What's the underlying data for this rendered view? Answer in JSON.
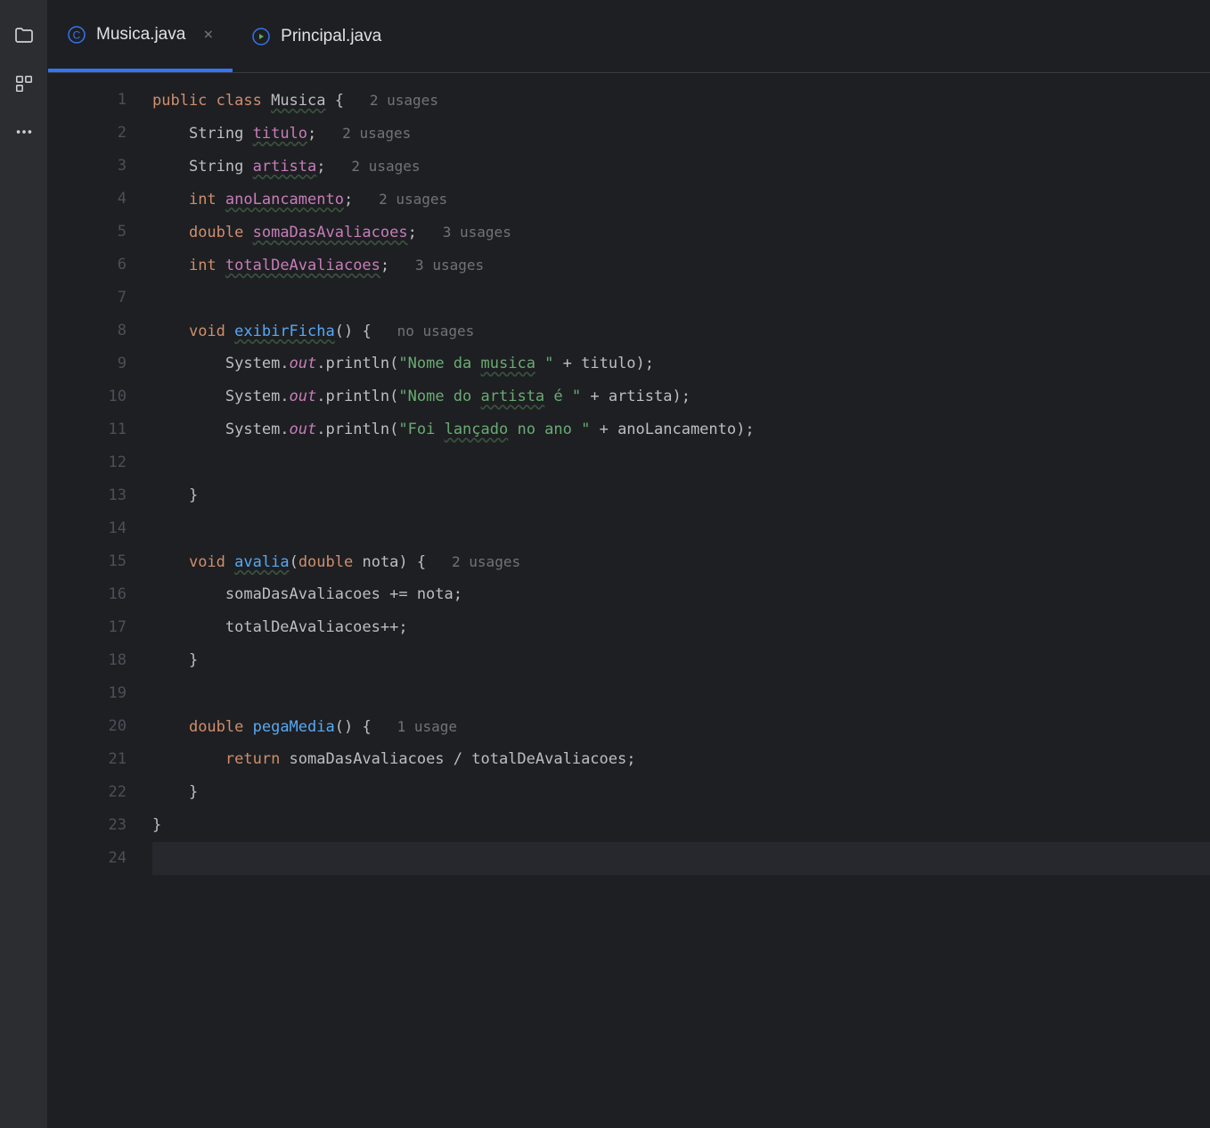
{
  "sidebar": {
    "icons": [
      "folder",
      "structure",
      "more"
    ]
  },
  "tabs": [
    {
      "label": "Musica.java",
      "icon": "class",
      "active": true,
      "closable": true
    },
    {
      "label": "Principal.java",
      "icon": "run-class",
      "active": false,
      "closable": false
    }
  ],
  "code": {
    "lines": [
      {
        "num": 1,
        "indent": 0,
        "tokens": [
          {
            "t": "public ",
            "c": "kw"
          },
          {
            "t": "class ",
            "c": "kw"
          },
          {
            "t": "Musica",
            "c": "ident uline"
          },
          {
            "t": " {",
            "c": "ident"
          }
        ],
        "hint": "2 usages"
      },
      {
        "num": 2,
        "indent": 1,
        "tokens": [
          {
            "t": "String ",
            "c": "ident"
          },
          {
            "t": "titulo",
            "c": "field uline"
          },
          {
            "t": ";",
            "c": "ident"
          }
        ],
        "hint": "2 usages"
      },
      {
        "num": 3,
        "indent": 1,
        "tokens": [
          {
            "t": "String ",
            "c": "ident"
          },
          {
            "t": "artista",
            "c": "field uline"
          },
          {
            "t": ";",
            "c": "ident"
          }
        ],
        "hint": "2 usages"
      },
      {
        "num": 4,
        "indent": 1,
        "tokens": [
          {
            "t": "int ",
            "c": "kw"
          },
          {
            "t": "anoLancamento",
            "c": "field uline"
          },
          {
            "t": ";",
            "c": "ident"
          }
        ],
        "hint": "2 usages"
      },
      {
        "num": 5,
        "indent": 1,
        "tokens": [
          {
            "t": "double ",
            "c": "kw"
          },
          {
            "t": "somaDasAvaliacoes",
            "c": "field uline"
          },
          {
            "t": ";",
            "c": "ident"
          }
        ],
        "hint": "3 usages"
      },
      {
        "num": 6,
        "indent": 1,
        "tokens": [
          {
            "t": "int ",
            "c": "kw"
          },
          {
            "t": "totalDeAvaliacoes",
            "c": "field uline"
          },
          {
            "t": ";",
            "c": "ident"
          }
        ],
        "hint": "3 usages"
      },
      {
        "num": 7,
        "indent": 0,
        "tokens": []
      },
      {
        "num": 8,
        "indent": 1,
        "tokens": [
          {
            "t": "void ",
            "c": "kw"
          },
          {
            "t": "exibirFicha",
            "c": "method uline"
          },
          {
            "t": "() {",
            "c": "ident"
          }
        ],
        "hint": "no usages"
      },
      {
        "num": 9,
        "indent": 2,
        "tokens": [
          {
            "t": "System.",
            "c": "ident"
          },
          {
            "t": "out",
            "c": "field italic"
          },
          {
            "t": ".println(",
            "c": "ident"
          },
          {
            "t": "\"Nome da ",
            "c": "str"
          },
          {
            "t": "musica",
            "c": "str uline"
          },
          {
            "t": " \"",
            "c": "str"
          },
          {
            "t": " + titulo);",
            "c": "ident"
          }
        ]
      },
      {
        "num": 10,
        "indent": 2,
        "tokens": [
          {
            "t": "System.",
            "c": "ident"
          },
          {
            "t": "out",
            "c": "field italic"
          },
          {
            "t": ".println(",
            "c": "ident"
          },
          {
            "t": "\"Nome do ",
            "c": "str"
          },
          {
            "t": "artista",
            "c": "str uline"
          },
          {
            "t": " é \"",
            "c": "str"
          },
          {
            "t": " + artista);",
            "c": "ident"
          }
        ]
      },
      {
        "num": 11,
        "indent": 2,
        "tokens": [
          {
            "t": "System.",
            "c": "ident"
          },
          {
            "t": "out",
            "c": "field italic"
          },
          {
            "t": ".println(",
            "c": "ident"
          },
          {
            "t": "\"Foi ",
            "c": "str"
          },
          {
            "t": "lançado",
            "c": "str uline"
          },
          {
            "t": " no ano \"",
            "c": "str"
          },
          {
            "t": " + anoLancamento);",
            "c": "ident"
          }
        ]
      },
      {
        "num": 12,
        "indent": 2,
        "tokens": []
      },
      {
        "num": 13,
        "indent": 1,
        "tokens": [
          {
            "t": "}",
            "c": "ident"
          }
        ]
      },
      {
        "num": 14,
        "indent": 0,
        "tokens": []
      },
      {
        "num": 15,
        "indent": 1,
        "tokens": [
          {
            "t": "void ",
            "c": "kw"
          },
          {
            "t": "avalia",
            "c": "method uline"
          },
          {
            "t": "(",
            "c": "ident"
          },
          {
            "t": "double ",
            "c": "kw"
          },
          {
            "t": "nota) {",
            "c": "ident"
          }
        ],
        "hint": "2 usages"
      },
      {
        "num": 16,
        "indent": 2,
        "tokens": [
          {
            "t": "somaDasAvaliacoes += nota;",
            "c": "ident"
          }
        ]
      },
      {
        "num": 17,
        "indent": 2,
        "tokens": [
          {
            "t": "totalDeAvaliacoes++;",
            "c": "ident"
          }
        ]
      },
      {
        "num": 18,
        "indent": 1,
        "tokens": [
          {
            "t": "}",
            "c": "ident"
          }
        ]
      },
      {
        "num": 19,
        "indent": 0,
        "tokens": []
      },
      {
        "num": 20,
        "indent": 1,
        "tokens": [
          {
            "t": "double ",
            "c": "kw"
          },
          {
            "t": "pegaMedia",
            "c": "method"
          },
          {
            "t": "() {",
            "c": "ident"
          }
        ],
        "hint": "1 usage"
      },
      {
        "num": 21,
        "indent": 2,
        "tokens": [
          {
            "t": "return ",
            "c": "kw"
          },
          {
            "t": "somaDasAvaliacoes / totalDeAvaliacoes;",
            "c": "ident"
          }
        ]
      },
      {
        "num": 22,
        "indent": 1,
        "tokens": [
          {
            "t": "}",
            "c": "ident"
          }
        ]
      },
      {
        "num": 23,
        "indent": 0,
        "tokens": [
          {
            "t": "}",
            "c": "ident"
          }
        ]
      },
      {
        "num": 24,
        "indent": 0,
        "tokens": [],
        "cursor": true
      }
    ]
  }
}
